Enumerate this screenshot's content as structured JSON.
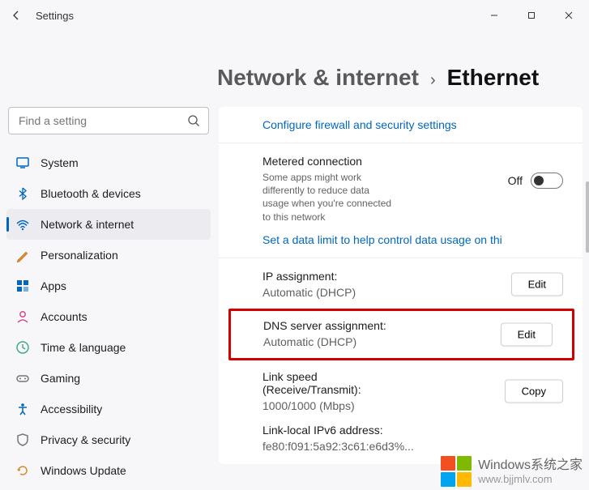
{
  "window": {
    "title": "Settings"
  },
  "search": {
    "placeholder": "Find a setting"
  },
  "sidebar": {
    "items": [
      {
        "label": "System"
      },
      {
        "label": "Bluetooth & devices"
      },
      {
        "label": "Network & internet"
      },
      {
        "label": "Personalization"
      },
      {
        "label": "Apps"
      },
      {
        "label": "Accounts"
      },
      {
        "label": "Time & language"
      },
      {
        "label": "Gaming"
      },
      {
        "label": "Accessibility"
      },
      {
        "label": "Privacy & security"
      },
      {
        "label": "Windows Update"
      }
    ]
  },
  "breadcrumb": {
    "parent": "Network & internet",
    "current": "Ethernet"
  },
  "firewall_link": "Configure firewall and security settings",
  "metered": {
    "title": "Metered connection",
    "desc": "Some apps might work differently to reduce data usage when you're connected to this network",
    "state": "Off",
    "set_limit": "Set a data limit to help control data usage on thi"
  },
  "ip": {
    "label": "IP assignment:",
    "value": "Automatic (DHCP)",
    "button": "Edit"
  },
  "dns": {
    "label": "DNS server assignment:",
    "value": "Automatic (DHCP)",
    "button": "Edit"
  },
  "linkspeed": {
    "label": "Link speed (Receive/Transmit):",
    "value": "1000/1000 (Mbps)",
    "button": "Copy"
  },
  "ipv6": {
    "label": "Link-local IPv6 address:",
    "value": "fe80:f091:5a92:3c61:e6d3%..."
  },
  "watermark": {
    "line1": "Windows系统之家",
    "line2": "www.bjjmlv.com"
  }
}
